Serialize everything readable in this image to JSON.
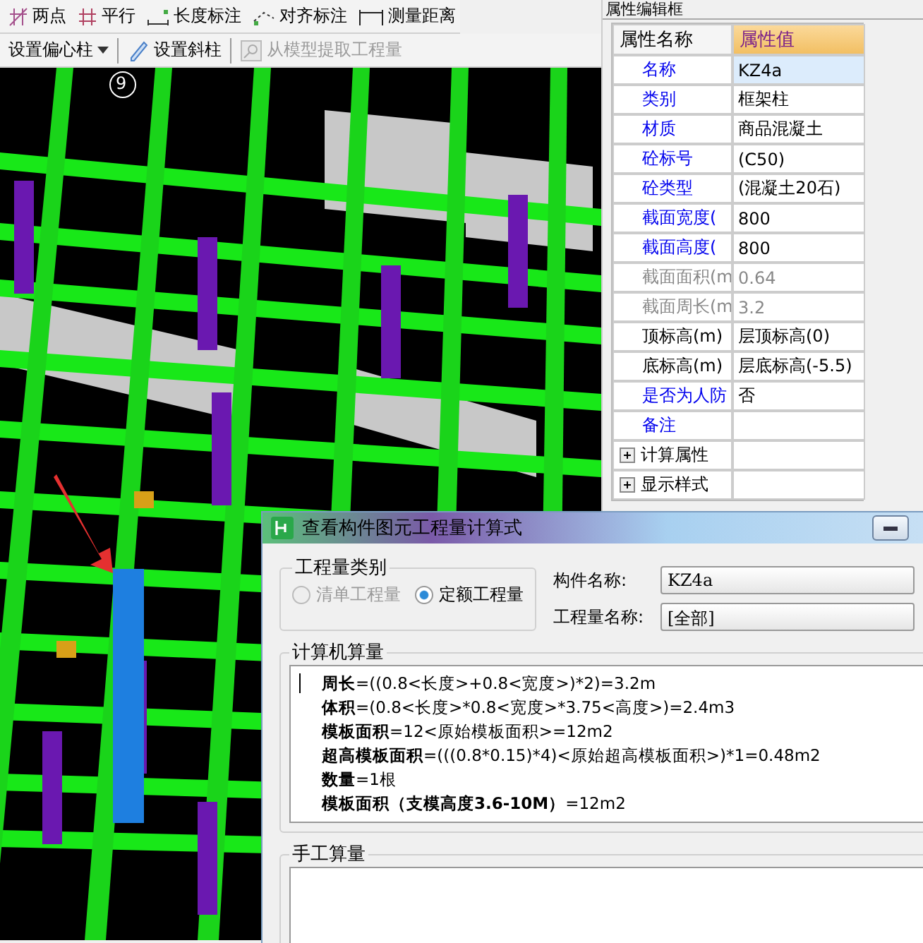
{
  "toolbar_rows": [
    [
      {
        "label": "两点"
      },
      {
        "label": "平行"
      },
      {
        "label": "长度标注"
      },
      {
        "label": "对齐标注"
      },
      {
        "label": "测量距离"
      }
    ],
    [
      {
        "label": "设置偏心柱",
        "dropdown": true,
        "disabled": false
      },
      {
        "label": "设置斜柱",
        "dropdown": false,
        "disabled": false
      },
      {
        "label": "从模型提取工程量",
        "dropdown": false,
        "disabled": true
      }
    ]
  ],
  "viewport": {
    "axis_label": "9"
  },
  "properties": {
    "title": "属性编辑框",
    "columns": [
      "属性名称",
      "属性值"
    ],
    "rows": [
      {
        "kind": "editable",
        "name": "名称",
        "value": "KZ4a",
        "selected": true
      },
      {
        "kind": "editable",
        "name": "类别",
        "value": "框架柱",
        "selected": false
      },
      {
        "kind": "editable",
        "name": "材质",
        "value": "商品混凝土",
        "selected": false
      },
      {
        "kind": "editable",
        "name": "砼标号",
        "value": "(C50)",
        "selected": false
      },
      {
        "kind": "editable",
        "name": "砼类型",
        "value": "(混凝土20石)",
        "selected": false
      },
      {
        "kind": "editable",
        "name": "截面宽度(",
        "value": "800",
        "selected": false
      },
      {
        "kind": "editable",
        "name": "截面高度(",
        "value": "800",
        "selected": false
      },
      {
        "kind": "readonly",
        "name": "截面面积(m",
        "value": "0.64",
        "selected": false
      },
      {
        "kind": "readonly",
        "name": "截面周长(m",
        "value": "3.2",
        "selected": false
      },
      {
        "kind": "plain",
        "name": "顶标高(m)",
        "value": "层顶标高(0)",
        "selected": false
      },
      {
        "kind": "plain",
        "name": "底标高(m)",
        "value": "层底标高(-5.5)",
        "selected": false
      },
      {
        "kind": "editable",
        "name": "是否为人防",
        "value": "否",
        "selected": false
      },
      {
        "kind": "editable",
        "name": "备注",
        "value": "",
        "selected": false
      },
      {
        "kind": "group",
        "name": "计算属性",
        "expanded": false,
        "selected": false
      },
      {
        "kind": "group",
        "name": "显示样式",
        "expanded": false,
        "selected": false
      }
    ]
  },
  "dialog": {
    "title": "查看构件图元工程量计算式",
    "category": {
      "legend": "工程量类别",
      "options": [
        {
          "label": "清单工程量",
          "selected": false,
          "disabled": true
        },
        {
          "label": "定额工程量",
          "selected": true,
          "disabled": false
        }
      ]
    },
    "fields": [
      {
        "label": "构件名称:",
        "value": "KZ4a"
      },
      {
        "label": "工程量名称:",
        "value": "[全部]"
      }
    ],
    "computer": {
      "legend": "计算机算量",
      "lines": [
        "**周长**=((0.8<长度>+0.8<宽度>)*2)=3.2m",
        "**体积**=(0.8<长度>*0.8<宽度>*3.75<高度>)=2.4m3",
        "**模板面积**=12<原始模板面积>=12m2",
        "**超高模板面积**=(((0.8*0.15)*4)<原始超高模板面积>)*1=0.48m2",
        "**数量**=1根",
        "**模板面积（支模高度3.6-10M）**=12m2"
      ]
    },
    "manual": {
      "legend": "手工算量"
    }
  }
}
